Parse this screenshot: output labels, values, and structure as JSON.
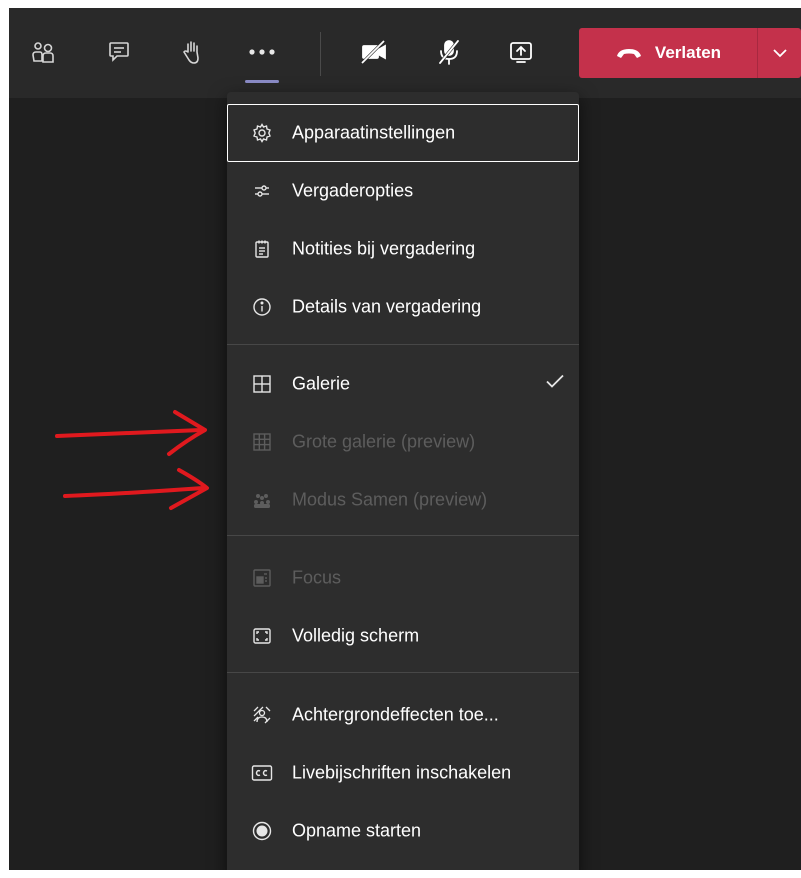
{
  "toolbar": {
    "buttons": [
      {
        "name": "people-icon"
      },
      {
        "name": "chat-icon"
      },
      {
        "name": "raise-hand-icon"
      },
      {
        "name": "more-options-icon"
      },
      {
        "name": "camera-off-icon"
      },
      {
        "name": "mic-off-icon"
      },
      {
        "name": "share-screen-icon"
      }
    ],
    "leave": {
      "label": "Verlaten",
      "color": "#c4314b"
    }
  },
  "menu": {
    "groups": [
      {
        "items": [
          {
            "label": "Apparaatinstellingen",
            "icon": "gear-icon",
            "focused": true
          },
          {
            "label": "Vergaderopties",
            "icon": "sliders-icon"
          },
          {
            "label": "Notities bij vergadering",
            "icon": "notes-icon"
          },
          {
            "label": "Details van vergadering",
            "icon": "info-icon"
          }
        ]
      },
      {
        "items": [
          {
            "label": "Galerie",
            "icon": "grid-icon",
            "checked": true
          },
          {
            "label": "Grote galerie (preview)",
            "icon": "large-grid-icon",
            "disabled": true
          },
          {
            "label": "Modus Samen (preview)",
            "icon": "together-mode-icon",
            "disabled": true
          }
        ]
      },
      {
        "items": [
          {
            "label": "Focus",
            "icon": "focus-icon",
            "disabled": true
          },
          {
            "label": "Volledig scherm",
            "icon": "fullscreen-icon"
          }
        ]
      },
      {
        "items": [
          {
            "label": "Achtergrondeffecten toe...",
            "icon": "background-effects-icon"
          },
          {
            "label": "Livebijschriften inschakelen",
            "icon": "captions-icon"
          },
          {
            "label": "Opname starten",
            "icon": "record-icon"
          }
        ]
      }
    ]
  },
  "colors": {
    "background": "#1f1f1f",
    "toolbar": "#292929",
    "menu": "#2d2d2d",
    "accent": "#8b8cc7",
    "annotation": "#e0191e"
  }
}
